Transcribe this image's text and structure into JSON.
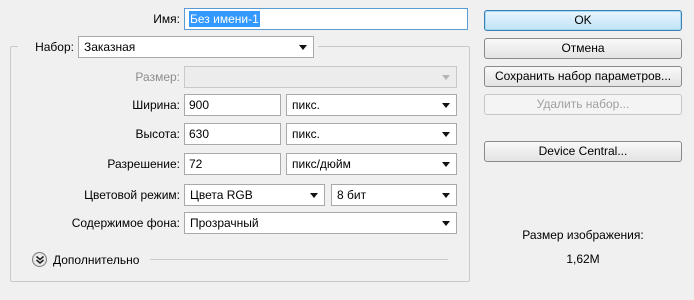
{
  "name_row": {
    "label": "Имя:",
    "value": "Без имени-1"
  },
  "preset": {
    "label": "Набор:",
    "value": "Заказная"
  },
  "size_row": {
    "label": "Размер:",
    "value": ""
  },
  "width_row": {
    "label": "Ширина:",
    "value": "900",
    "unit": "пикс."
  },
  "height_row": {
    "label": "Высота:",
    "value": "630",
    "unit": "пикс."
  },
  "resolution_row": {
    "label": "Разрешение:",
    "value": "72",
    "unit": "пикс/дюйм"
  },
  "color_mode_row": {
    "label": "Цветовой режим:",
    "mode": "Цвета RGB",
    "depth": "8 бит"
  },
  "background_row": {
    "label": "Содержимое фона:",
    "value": "Прозрачный"
  },
  "advanced": {
    "label": "Дополнительно",
    "icon": "double-chevron-down-icon"
  },
  "buttons": {
    "ok": "OK",
    "cancel": "Отмена",
    "save_preset": "Сохранить набор параметров...",
    "delete_preset": "Удалить набор...",
    "device_central": "Device Central..."
  },
  "image_size": {
    "label": "Размер изображения:",
    "value": "1,62M"
  },
  "colors": {
    "selection": "#3399ff",
    "default_button_border": "#3c7fb1",
    "disabled_text": "#a0a0a0"
  }
}
